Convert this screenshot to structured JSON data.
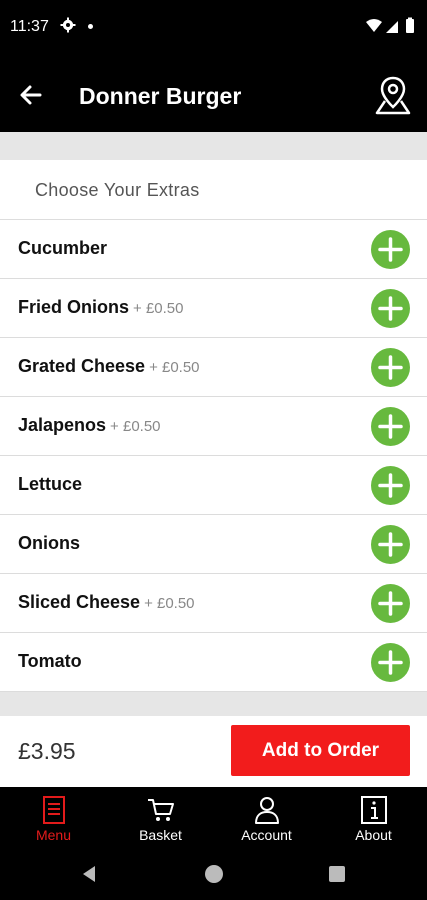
{
  "status_bar": {
    "time": "11:37",
    "icons": [
      "gear-icon",
      "notification-dot-icon",
      "wifi-icon",
      "signal-icon",
      "battery-icon"
    ]
  },
  "header": {
    "title": "Donner Burger",
    "back_icon": "arrow-left-icon",
    "map_icon": "map-pin-icon"
  },
  "extras": {
    "section_title": "Choose Your Extras",
    "items": [
      {
        "name": "Cucumber",
        "price": ""
      },
      {
        "name": "Fried Onions",
        "price": "+ £0.50"
      },
      {
        "name": "Grated Cheese",
        "price": "+ £0.50"
      },
      {
        "name": "Jalapenos",
        "price": "+ £0.50"
      },
      {
        "name": "Lettuce",
        "price": ""
      },
      {
        "name": "Onions",
        "price": ""
      },
      {
        "name": "Sliced Cheese",
        "price": "+ £0.50"
      },
      {
        "name": "Tomato",
        "price": ""
      }
    ]
  },
  "footer": {
    "total": "£3.95",
    "add_button_label": "Add to Order"
  },
  "bottom_nav": {
    "items": [
      {
        "label": "Menu",
        "icon": "menu-list-icon",
        "active": true
      },
      {
        "label": "Basket",
        "icon": "cart-icon",
        "active": false
      },
      {
        "label": "Account",
        "icon": "person-icon",
        "active": false
      },
      {
        "label": "About",
        "icon": "info-icon",
        "active": false
      }
    ]
  },
  "colors": {
    "accent_green": "#67b93e",
    "accent_red": "#f21c1c",
    "active_nav": "#e31b1b",
    "header_bg": "#000000"
  }
}
